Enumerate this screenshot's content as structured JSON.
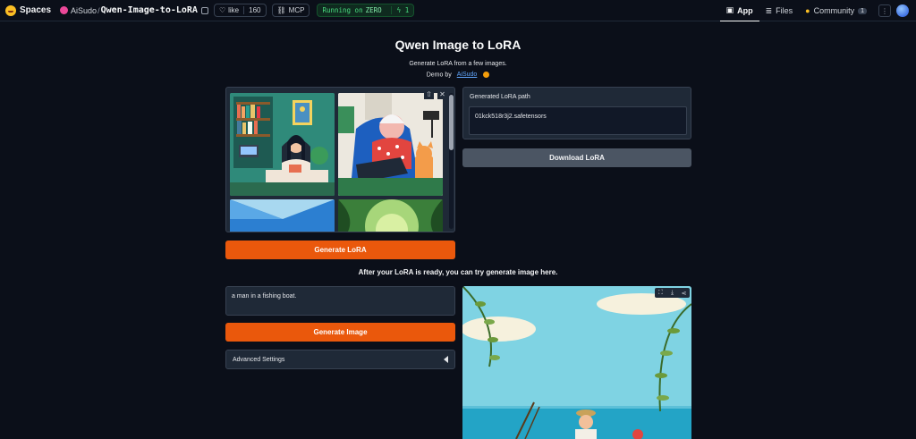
{
  "topbar": {
    "spaces_label": "Spaces",
    "owner": "AiSudo",
    "separator": "/",
    "repo": "Qwen-Image-to-LoRA",
    "like_label": "like",
    "like_count": "160",
    "mcp_label": "MCP",
    "running_label": "Running on",
    "running_hw": "ZERO",
    "replicas": "1",
    "nav": [
      {
        "label": "App",
        "icon": "app-grid-icon",
        "active": true
      },
      {
        "label": "Files",
        "icon": "files-icon",
        "active": false
      },
      {
        "label": "Community",
        "icon": "community-icon",
        "active": false,
        "badge": "1"
      }
    ]
  },
  "header": {
    "title": "Qwen Image to LoRA",
    "subtitle": "Generate LoRA from a few images.",
    "demo_prefix": "Demo by",
    "demo_link": "AiSudo"
  },
  "lora": {
    "generate_label": "Generate LoRA",
    "path_label": "Generated LoRA path",
    "path_value": "01kck518r3j2.safetensors",
    "download_label": "Download LoRA"
  },
  "image_gen": {
    "after_text": "After your LoRA is ready, you can try generate image here.",
    "prompt_value": "a man in a fishing boat.",
    "generate_label": "Generate Image",
    "advanced_label": "Advanced Settings"
  },
  "colors": {
    "accent": "#ea580c",
    "background": "#0b0f19",
    "panel": "#1f2937",
    "link": "#60a5fa",
    "running_green": "#4ade80"
  }
}
